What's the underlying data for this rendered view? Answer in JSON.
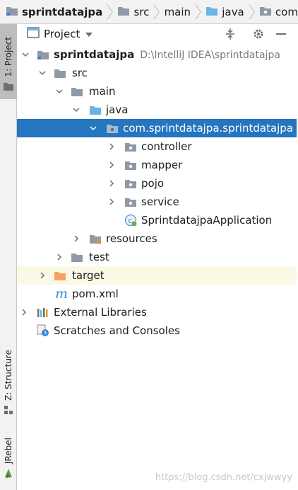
{
  "breadcrumb": [
    {
      "label": "sprintdatajpa",
      "icon": "module-folder-icon"
    },
    {
      "label": "src",
      "icon": "folder-icon"
    },
    {
      "label": "main",
      "icon": null
    },
    {
      "label": "java",
      "icon": "source-folder-icon"
    },
    {
      "label": "com",
      "icon": "package-folder-icon"
    }
  ],
  "sidebar": {
    "project_tab": "1: Project",
    "structure_tab": "Z: Structure",
    "jrebel_tab": "JRebel"
  },
  "tool_window": {
    "title": "Project",
    "buttons": [
      "collapse-all-icon",
      "gear-icon",
      "hide-icon"
    ]
  },
  "tree": {
    "root": {
      "label": "sprintdatajpa",
      "path": "D:\\IntelliJ IDEA\\sprintdatajpa"
    },
    "src": "src",
    "main": "main",
    "java": "java",
    "package": "com.sprintdatajpa.sprintdatajpa",
    "controller": "controller",
    "mapper": "mapper",
    "pojo": "pojo",
    "service": "service",
    "app_class": "SprintdatajpaApplication",
    "resources": "resources",
    "test": "test",
    "target": "target",
    "pom": "pom.xml",
    "external_libraries": "External Libraries",
    "scratches": "Scratches and Consoles"
  },
  "colors": {
    "selection": "#2675bf",
    "folder": "#8f9aa6",
    "source_folder": "#6cb4e4",
    "target_folder": "#f4a460",
    "excluded_bg": "#fbf9e6"
  },
  "watermark": "https://blog.csdn.net/cxjwwyy"
}
